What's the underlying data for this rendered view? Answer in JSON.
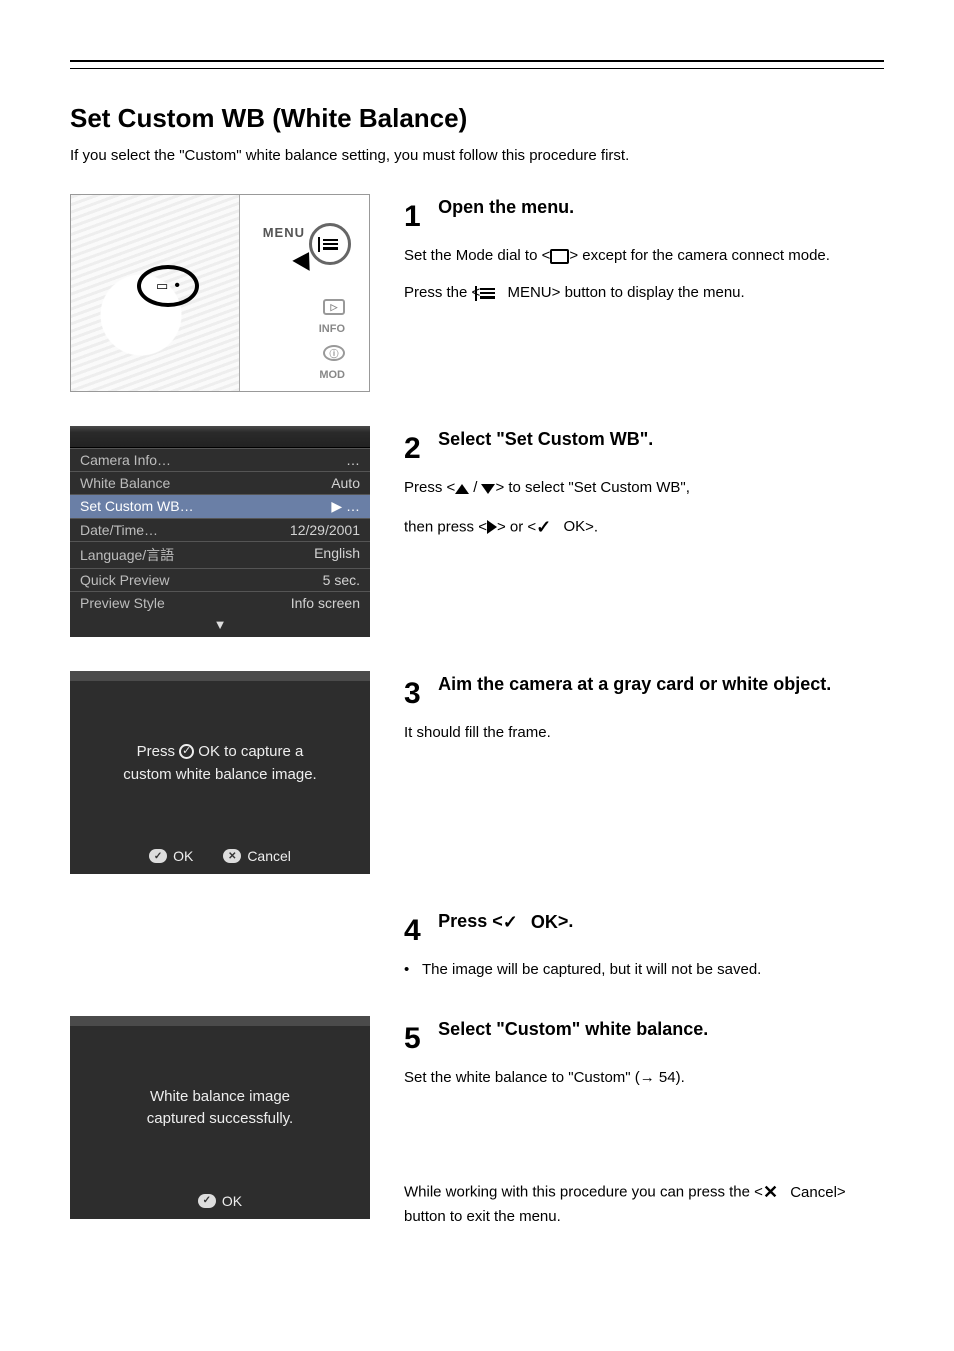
{
  "header": {
    "section_title": "Set Custom WB (White Balance)",
    "intro": "If you select the \"Custom\" white balance setting, you must follow this procedure first."
  },
  "step1": {
    "head": "Open the menu.",
    "line_a_before": "Set the Mode dial to <",
    "line_a_after": "> except for the camera connect mode.",
    "line_b_before": "Press the <",
    "line_b_mid": "MENU",
    "line_b_after": "> button to display the menu.",
    "illus": {
      "menu_label": "MENU",
      "side_labels": {
        "play": "▷",
        "info": "INFO",
        "i": "ⓘ",
        "mod": "MOD"
      }
    }
  },
  "step2": {
    "head": "Select \"Set Custom WB\".",
    "line_a_before": "Press <",
    "line_a_after": "> to select \"Set Custom WB\",",
    "line_b_before": "then press <",
    "line_b_mid": "> or <",
    "line_b_ok": "OK",
    "line_b_after": ">.",
    "menu": {
      "rows": [
        {
          "label": "Camera Info…",
          "value": "…"
        },
        {
          "label": "White Balance",
          "value": "Auto"
        },
        {
          "label": "Set Custom WB…",
          "value": "▶ …",
          "selected": true
        },
        {
          "label": "Date/Time…",
          "value": "12/29/2001"
        },
        {
          "label": "Language/言語",
          "value": "English"
        },
        {
          "label": "Quick Preview",
          "value": "5 sec."
        },
        {
          "label": "Preview Style",
          "value": "Info screen"
        }
      ]
    }
  },
  "step3": {
    "head": "Aim the camera at a gray card or white object.",
    "line_a": "It should fill the frame.",
    "panel": {
      "line1_a": "Press ",
      "line1_b": " OK to capture a",
      "line2": "custom white balance image.",
      "ok": "OK",
      "cancel": "Cancel"
    }
  },
  "step4": {
    "head_before": "Press <",
    "head_ok": "OK",
    "head_after": ">.",
    "bullet": "The image will be captured, but it will not be saved."
  },
  "step5": {
    "head": "Select \"Custom\" white balance.",
    "line_a": "Set the white balance to \"Custom\" (→ 54).",
    "panel": {
      "line1": "White balance image",
      "line2": "captured successfully.",
      "ok": "OK"
    },
    "note_before": "While working with this procedure you can press the <",
    "note_cancel": "Cancel",
    "note_after": "> button to exit the menu."
  }
}
